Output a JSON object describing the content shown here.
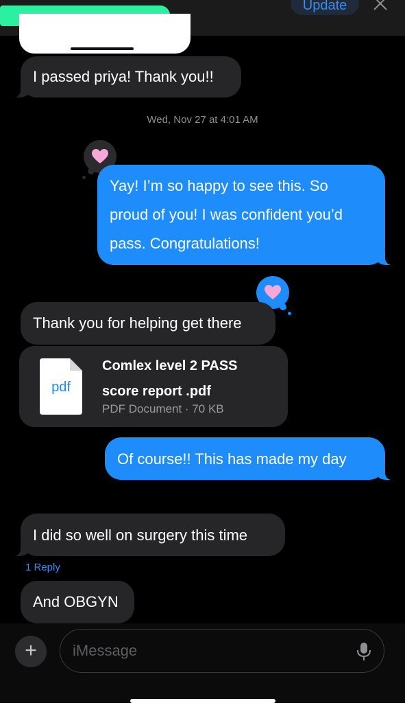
{
  "header": {
    "update_label": "Update"
  },
  "timestamp": "Wed, Nov 27 at 4:01 AM",
  "messages": [
    {
      "text": "I passed priya! Thank you!!"
    },
    {
      "text_lines": [
        "Yay! I’m so happy to see this. So",
        "proud of you! I was confident you’d",
        "pass. Congratulations!"
      ]
    },
    {
      "text": "Thank you for helping get there"
    },
    {
      "text": "Of course!! This has made my day"
    },
    {
      "text": "I did so well on surgery this time"
    },
    {
      "text": "And OBGYN"
    }
  ],
  "attachment": {
    "icon_label": "pdf",
    "name_line1": "Comlex level 2 PASS",
    "name_line2": "score report .pdf",
    "meta": "PDF Document · 70 KB"
  },
  "reply_count": "1 Reply",
  "composer": {
    "placeholder": "iMessage",
    "plus_label": "+"
  },
  "colors": {
    "outgoing": "#1e8cfa",
    "incoming": "#262628",
    "redaction": "#2af0a0",
    "heart": "#f6a8d8"
  }
}
